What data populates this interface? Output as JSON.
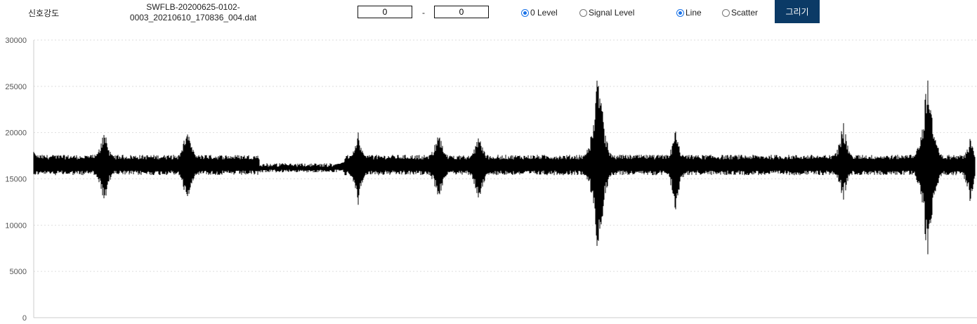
{
  "header": {
    "signal_label": "신호강도",
    "file_line1": "SWFLB-20200625-0102-",
    "file_line2": "0003_20210610_170836_004.dat"
  },
  "range": {
    "from": "0",
    "separator": "-",
    "to": "0"
  },
  "level_options": [
    {
      "label": "0 Level",
      "checked": true
    },
    {
      "label": "Signal Level",
      "checked": false
    }
  ],
  "plot_options": [
    {
      "label": "Line",
      "checked": true
    },
    {
      "label": "Scatter",
      "checked": false
    }
  ],
  "draw_button": "그리기",
  "colors": {
    "button_bg": "#0b3a66",
    "radio_accent": "#1a73e8",
    "trace": "#000000",
    "grid": "#dddddd"
  },
  "chart_data": {
    "type": "line",
    "title": "",
    "xlabel": "",
    "ylabel": "",
    "ylim": [
      0,
      30000
    ],
    "yticks": [
      "0",
      "5000",
      "10000",
      "15000",
      "20000",
      "25000",
      "30000"
    ],
    "grid": "horizontal dotted",
    "legend": "none",
    "baseline": 16500,
    "noise_amplitude": 1000,
    "series": [
      {
        "bursts": [
          {
            "x": 0.0,
            "min": 15300,
            "max": 18200
          },
          {
            "x": 0.075,
            "min": 11500,
            "max": 21000
          },
          {
            "x": 0.163,
            "min": 11600,
            "max": 21300
          },
          {
            "x": 0.344,
            "min": 11600,
            "max": 20500
          },
          {
            "x": 0.43,
            "min": 11700,
            "max": 21000
          },
          {
            "x": 0.473,
            "min": 11600,
            "max": 20500
          },
          {
            "x": 0.6,
            "min": 4800,
            "max": 28700
          },
          {
            "x": 0.682,
            "min": 11200,
            "max": 20500
          },
          {
            "x": 0.86,
            "min": 12200,
            "max": 21700
          },
          {
            "x": 0.95,
            "min": 3700,
            "max": 28600
          },
          {
            "x": 0.995,
            "min": 12200,
            "max": 19600
          }
        ]
      }
    ]
  }
}
